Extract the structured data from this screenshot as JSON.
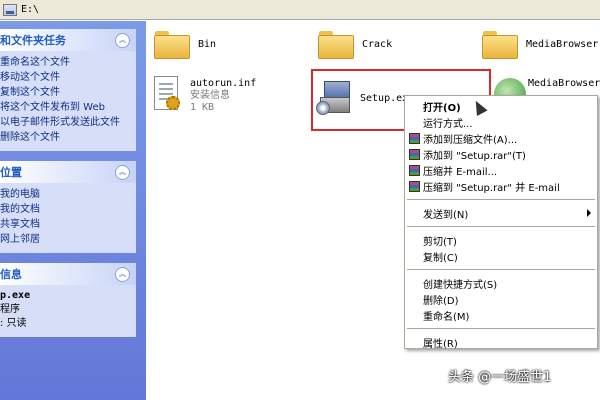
{
  "address_bar": {
    "path": "E:\\"
  },
  "left_pane": {
    "tasks": {
      "title": "和文件夹任务",
      "items": [
        "重命名这个文件",
        "移动这个文件",
        "复制这个文件",
        "将这个文件发布到 Web",
        "以电子邮件形式发送此文件",
        "删除这个文件"
      ]
    },
    "places": {
      "title": "位置",
      "items": [
        "我的电脑",
        "我的文档",
        "共享文档",
        "网上邻居"
      ]
    },
    "details": {
      "title": "信息",
      "name": "p.exe",
      "type": "程序",
      "attr": ": 只读"
    }
  },
  "files": {
    "bin": "Bin",
    "crack": "Crack",
    "media_browser_folder": "MediaBrowser",
    "autorun_name": "autorun.inf",
    "autorun_type": "安装信息",
    "autorun_size": "1 KB",
    "setup_name": "Setup.ex",
    "media_browser_file": "MediaBrowser."
  },
  "context_menu": {
    "items": [
      {
        "label": "打开(O)",
        "bold": true
      },
      {
        "label": "运行方式..."
      },
      {
        "label": "添加到压缩文件(A)...",
        "rar": true
      },
      {
        "label": "添加到 \"Setup.rar\"(T)",
        "rar": true
      },
      {
        "label": "压缩并 E-mail...",
        "rar": true
      },
      {
        "label": "压缩到 \"Setup.rar\" 并 E-mail",
        "rar": true
      },
      {
        "label": "发送到(N)",
        "submenu": true
      },
      {
        "label": "剪切(T)"
      },
      {
        "label": "复制(C)"
      },
      {
        "label": "创建快捷方式(S)"
      },
      {
        "label": "删除(D)"
      },
      {
        "label": "重命名(M)"
      },
      {
        "label": "属性(R)"
      }
    ]
  },
  "watermark": "头条 @一场盛世1"
}
